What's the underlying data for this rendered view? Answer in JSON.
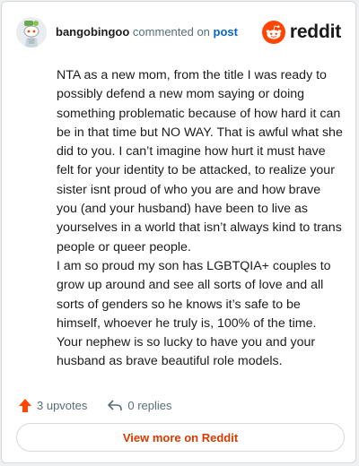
{
  "header": {
    "username": "bangobingoo",
    "action_text": " commented on ",
    "post_link": "post",
    "logo_text": "reddit",
    "icons": {
      "avatar": "snoo-avatar-icon",
      "logo": "reddit-logo-icon"
    }
  },
  "comment": {
    "paragraphs": [
      "NTA as a new mom, from the title I was ready to possibly defend a new mom saying or doing something problematic because of how hard it can be in that time but NO WAY. That is awful what she did to you. I can’t imagine how hurt it must have felt for your identity to be attacked, to realize your sister isnt proud of who you are and how brave you (and your husband) have been to live as yourselves in a world that isn’t always kind to trans people or queer people.",
      "I am so proud my son has LGBTQIA+ couples to grow up around and see all sorts of love and all sorts of genders so he knows it’s safe to be himself, whoever he truly is, 100% of the time. Your nephew is so lucky to have you and your husband as brave beautiful role models."
    ]
  },
  "actions": {
    "upvotes_label": "3 upvotes",
    "replies_label": "0 replies",
    "icons": {
      "upvote": "upvote-arrow-icon",
      "reply": "reply-arrow-icon"
    }
  },
  "footer": {
    "view_more_label": "View more on Reddit"
  },
  "colors": {
    "brand": "#ff4500",
    "link": "#0a65c8",
    "button_text": "#d93a00",
    "muted": "#576f76"
  }
}
